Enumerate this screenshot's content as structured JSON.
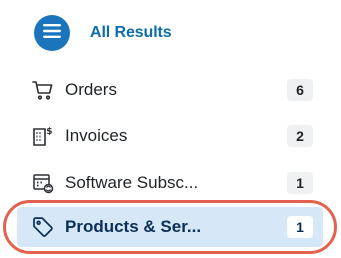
{
  "header": {
    "title": "All Results",
    "menu_icon": "hamburger-icon"
  },
  "nav_items": [
    {
      "label": "Orders",
      "count": "6",
      "icon": "cart-icon"
    },
    {
      "label": "Invoices",
      "count": "2",
      "icon": "invoice-icon"
    },
    {
      "label": "Software Subsc...",
      "count": "1",
      "icon": "subscription-icon"
    },
    {
      "label": "Products & Ser...",
      "count": "1",
      "icon": "tag-icon",
      "selected": true
    }
  ],
  "colors": {
    "accent": "#1b75bc",
    "title": "#0d6ead",
    "selected_bg": "#d6e8f8",
    "highlight_outline": "#e2624f"
  }
}
